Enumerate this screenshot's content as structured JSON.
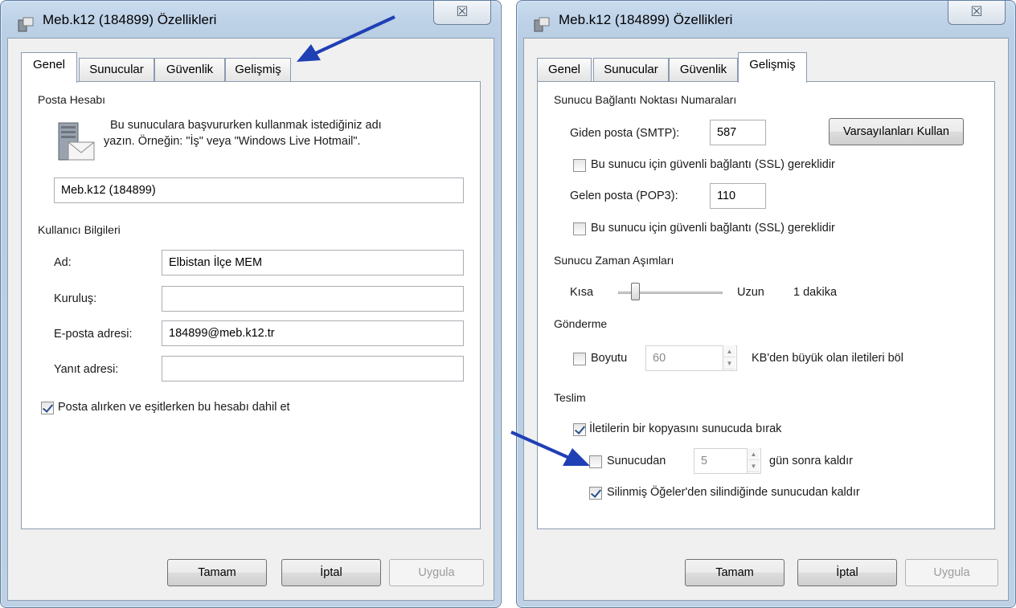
{
  "window_title": "Meb.k12 (184899) Özellikleri",
  "close_glyph": "☒",
  "tabs": [
    "Genel",
    "Sunucular",
    "Güvenlik",
    "Gelişmiş"
  ],
  "left": {
    "account_group": "Posta Hesabı",
    "account_desc_line1": "Bu sunuculara başvururken kullanmak istediğiniz adı",
    "account_desc_line2": "yazın.  Örneğin: \"İş\" veya \"Windows Live Hotmail\".",
    "account_name": "Meb.k12 (184899)",
    "user_group": "Kullanıcı Bilgileri",
    "name_label": "Ad:",
    "name_value": "Elbistan İlçe MEM",
    "org_label": "Kuruluş:",
    "org_value": "",
    "email_label": "E-posta adresi:",
    "email_value": "184899@meb.k12.tr",
    "reply_label": "Yanıt adresi:",
    "reply_value": "",
    "include_label": "Posta alırken ve eşitlerken bu hesabı dahil et",
    "include_checked": true
  },
  "right": {
    "ports_group": "Sunucu Bağlantı Noktası Numaraları",
    "smtp_label": "Giden posta (SMTP):",
    "smtp_value": "587",
    "defaults_button": "Varsayılanları Kullan",
    "smtp_ssl_label": "Bu sunucu için güvenli bağlantı (SSL) gereklidir",
    "pop3_label": "Gelen posta (POP3):",
    "pop3_value": "110",
    "pop3_ssl_label": "Bu sunucu için güvenli bağlantı (SSL) gereklidir",
    "timeouts_group": "Sunucu Zaman Aşımları",
    "short_label": "Kısa",
    "long_label": "Uzun",
    "timeout_value": "1 dakika",
    "sending_group": "Gönderme",
    "size_label": "Boyutu",
    "size_value": "60",
    "split_label": "KB'den büyük olan iletileri böl",
    "delivery_group": "Teslim",
    "leave_copy_label": "İletilerin bir kopyasını sunucuda bırak",
    "remove_label": "Sunucudan",
    "remove_days": "5",
    "remove_after_label": "gün sonra kaldır",
    "deleted_label": "Silinmiş Öğeler'den silindiğinde sunucudan kaldır"
  },
  "buttons": {
    "ok": "Tamam",
    "cancel": "İptal",
    "apply": "Uygula"
  }
}
